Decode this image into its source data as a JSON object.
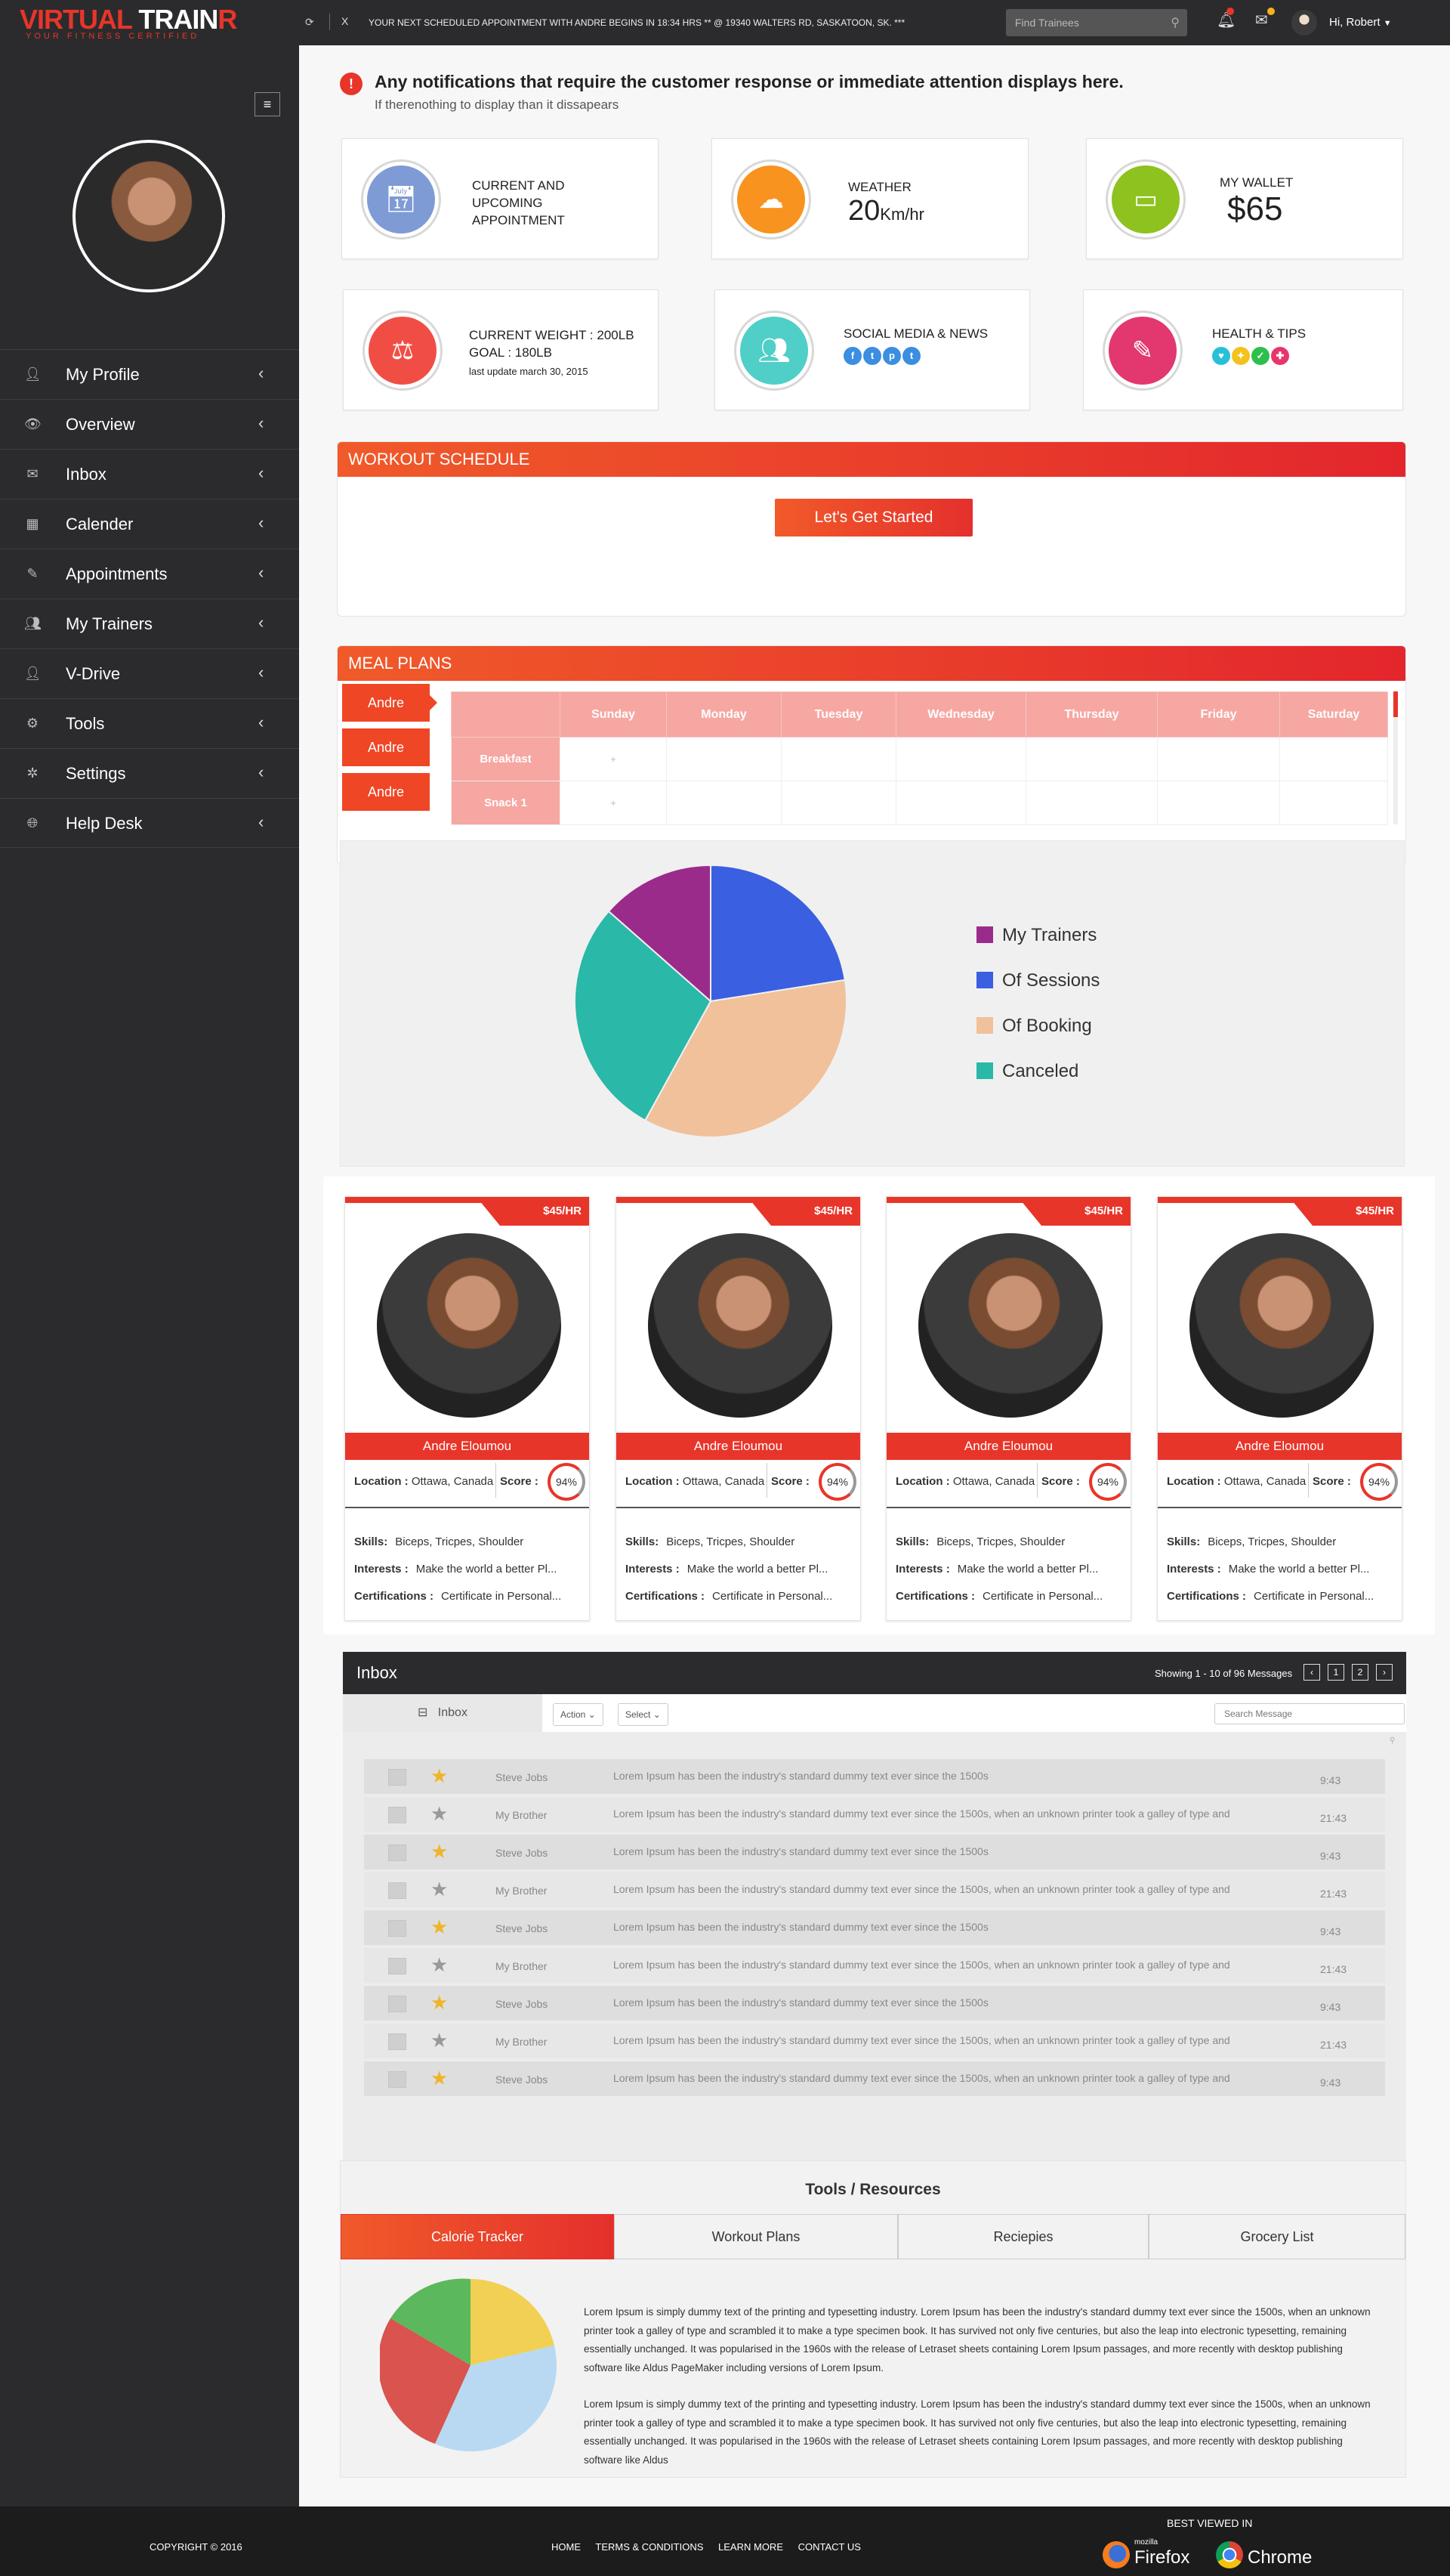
{
  "app": {
    "logo_part1": "VIRTUAL ",
    "logo_part2": "TRAIN",
    "logo_part3": "R",
    "tagline": "YOUR FITNESS CERTIFIED"
  },
  "topbar": {
    "refresh_icon": "refresh-icon",
    "close_label": "X",
    "ticker": "YOUR NEXT SCHEDULED APPOINTMENT WITH ANDRE BEGINS IN 18:34 HRS ** @ 19340 WALTERS RD, SASKATOON, SK. ***",
    "search_placeholder": "Find Trainees",
    "greeting": "Hi, Robert"
  },
  "sidebar": {
    "items": [
      {
        "label": "My Profile",
        "icon": "user-icon"
      },
      {
        "label": "Overview",
        "icon": "eye-icon"
      },
      {
        "label": "Inbox",
        "icon": "envelope-icon"
      },
      {
        "label": "Calender",
        "icon": "calendar-icon"
      },
      {
        "label": "Appointments",
        "icon": "edit-icon"
      },
      {
        "label": "My Trainers",
        "icon": "users-icon"
      },
      {
        "label": "V-Drive",
        "icon": "user-icon"
      },
      {
        "label": "Tools",
        "icon": "cogs-icon"
      },
      {
        "label": "Settings",
        "icon": "gear-icon"
      },
      {
        "label": "Help Desk",
        "icon": "globe-icon"
      }
    ]
  },
  "notification": {
    "title": "Any notifications that require the customer response or immediate attention displays here.",
    "subtitle": "If therenothing to display than it dissapears"
  },
  "cards": {
    "appointment": {
      "line1": "CURRENT AND",
      "line2": "UPCOMING",
      "line3": "APPOINTMENT",
      "color": "#7f9bd6"
    },
    "weather": {
      "label": "WEATHER",
      "value": "20",
      "unit": "Km/hr",
      "color": "#f7931e"
    },
    "wallet": {
      "label": "MY WALLET",
      "value": "$65",
      "color": "#8dc21f"
    },
    "weight": {
      "line1": "CURRENT WEIGHT : 200LB",
      "line2": "GOAL : 180LB",
      "updated": "last update march 30, 2015",
      "color": "#f04e45"
    },
    "social": {
      "label": "SOCIAL MEDIA & NEWS",
      "links": [
        "f",
        "t",
        "p",
        "t"
      ],
      "color": "#4fcfc7"
    },
    "health": {
      "label": "HEALTH & TIPS",
      "color": "#e2386f"
    }
  },
  "workout": {
    "title": "WORKOUT SCHEDULE",
    "button": "Let's Get Started"
  },
  "meals": {
    "title": "MEAL PLANS",
    "people": [
      "Andre",
      "Andre",
      "Andre"
    ],
    "days": [
      "Sunday",
      "Monday",
      "Tuesday",
      "Wednesday",
      "Thursday",
      "Friday",
      "Saturday"
    ],
    "rows": [
      {
        "label": "Breakfast",
        "first": "+"
      },
      {
        "label": "Snack 1",
        "first": "+"
      }
    ]
  },
  "chart_data": {
    "type": "pie",
    "labels": [
      "My Trainers",
      "Of Sessions",
      "Of Booking",
      "Canceled"
    ],
    "values": [
      13.5,
      22.5,
      35.5,
      28.5
    ],
    "colors": [
      "#9b2b8a",
      "#3a5fe0",
      "#f0c19a",
      "#2ab8a8"
    ],
    "legend": "right"
  },
  "trainers": [
    {
      "price": "$45/HR",
      "name": "Andre Eloumou",
      "location_label": "Location :",
      "location": "Ottawa, Canada",
      "score_label": "Score :",
      "score": "94%",
      "skills_label": "Skills:",
      "skills": "Biceps, Tricpes, Shoulder",
      "interests_label": "Interests :",
      "interests": "Make the world a better Pl...",
      "cert_label": "Certifications :",
      "cert": "Certificate in Personal..."
    },
    {
      "price": "$45/HR",
      "name": "Andre Eloumou",
      "location_label": "Location :",
      "location": "Ottawa, Canada",
      "score_label": "Score :",
      "score": "94%",
      "skills_label": "Skills:",
      "skills": "Biceps, Tricpes, Shoulder",
      "interests_label": "Interests :",
      "interests": "Make the world a better Pl...",
      "cert_label": "Certifications :",
      "cert": "Certificate in Personal..."
    },
    {
      "price": "$45/HR",
      "name": "Andre Eloumou",
      "location_label": "Location :",
      "location": "Ottawa, Canada",
      "score_label": "Score :",
      "score": "94%",
      "skills_label": "Skills:",
      "skills": "Biceps, Tricpes, Shoulder",
      "interests_label": "Interests :",
      "interests": "Make the world a better Pl...",
      "cert_label": "Certifications :",
      "cert": "Certificate in Personal..."
    },
    {
      "price": "$45/HR",
      "name": "Andre Eloumou",
      "location_label": "Location :",
      "location": "Ottawa, Canada",
      "score_label": "Score :",
      "score": "94%",
      "skills_label": "Skills:",
      "skills": "Biceps, Tricpes, Shoulder",
      "interests_label": "Interests :",
      "interests": "Make the world a better Pl...",
      "cert_label": "Certifications :",
      "cert": "Certificate in Personal..."
    }
  ],
  "inbox": {
    "title": "Inbox",
    "showing": "Showing 1 - 10 of 96 Messages",
    "pages": [
      "1",
      "2"
    ],
    "tab": "Inbox",
    "action_label": "Action",
    "select_label": "Select",
    "search_placeholder": "Search Message",
    "messages": [
      {
        "from": "Steve Jobs",
        "subject": "Lorem Ipsum has been the industry's standard dummy text ever since the 1500s",
        "time": "9:43",
        "starred": true
      },
      {
        "from": "My Brother",
        "subject": "Lorem Ipsum has been the industry's standard dummy text ever since the 1500s, when an unknown printer took a galley of type and",
        "time": "21:43",
        "starred": false
      },
      {
        "from": "Steve Jobs",
        "subject": "Lorem Ipsum has been the industry's standard dummy text ever since the 1500s",
        "time": "9:43",
        "starred": true
      },
      {
        "from": "My Brother",
        "subject": "Lorem Ipsum has been the industry's standard dummy text ever since the 1500s, when an unknown printer took a galley of type and",
        "time": "21:43",
        "starred": false
      },
      {
        "from": "Steve Jobs",
        "subject": "Lorem Ipsum has been the industry's standard dummy text ever since the 1500s",
        "time": "9:43",
        "starred": true
      },
      {
        "from": "My Brother",
        "subject": "Lorem Ipsum has been the industry's standard dummy text ever since the 1500s, when an unknown printer took a galley of type and",
        "time": "21:43",
        "starred": false
      },
      {
        "from": "Steve Jobs",
        "subject": "Lorem Ipsum has been the industry's standard dummy text ever since the 1500s",
        "time": "9:43",
        "starred": true
      },
      {
        "from": "My Brother",
        "subject": "Lorem Ipsum has been the industry's standard dummy text ever since the 1500s, when an unknown printer took a galley of type and",
        "time": "21:43",
        "starred": false
      },
      {
        "from": "Steve Jobs",
        "subject": "Lorem Ipsum has been the industry's standard dummy text ever since the 1500s, when an unknown printer took a galley of type and",
        "time": "9:43",
        "starred": true
      }
    ]
  },
  "tools": {
    "title": "Tools / Resources",
    "tabs": [
      "Calorie Tracker",
      "Workout Plans",
      "Reciepies",
      "Grocery List"
    ],
    "para1": "Lorem Ipsum is simply dummy text of the printing and typesetting industry. Lorem Ipsum has been the industry's standard dummy text ever since the 1500s, when an unknown printer took a galley of type and scrambled it to make a type specimen book. It has survived not only five centuries, but also the leap into electronic typesetting, remaining essentially unchanged. It was popularised in the 1960s with the release of Letraset sheets containing Lorem Ipsum passages, and more recently with desktop publishing software like Aldus PageMaker including versions of Lorem Ipsum.",
    "para2": "Lorem Ipsum is simply dummy text of the printing and typesetting industry. Lorem Ipsum has been the industry's standard dummy text ever since the 1500s, when an unknown printer took a galley of type and scrambled it to make a type specimen book. It has survived not only five centuries, but also the leap into electronic typesetting, remaining essentially unchanged. It was popularised in the 1960s with the release of Letraset sheets containing Lorem Ipsum passages, and more recently with desktop publishing software like Aldus"
  },
  "footer": {
    "copyright": "COPYRIGHT © 2016",
    "links": [
      "HOME",
      "TERMS & CONDITIONS",
      "LEARN MORE",
      "CONTACT US"
    ],
    "best_viewed": "BEST VIEWED IN",
    "firefox_sub": "mozilla",
    "firefox": "Firefox",
    "chrome": "Chrome"
  }
}
